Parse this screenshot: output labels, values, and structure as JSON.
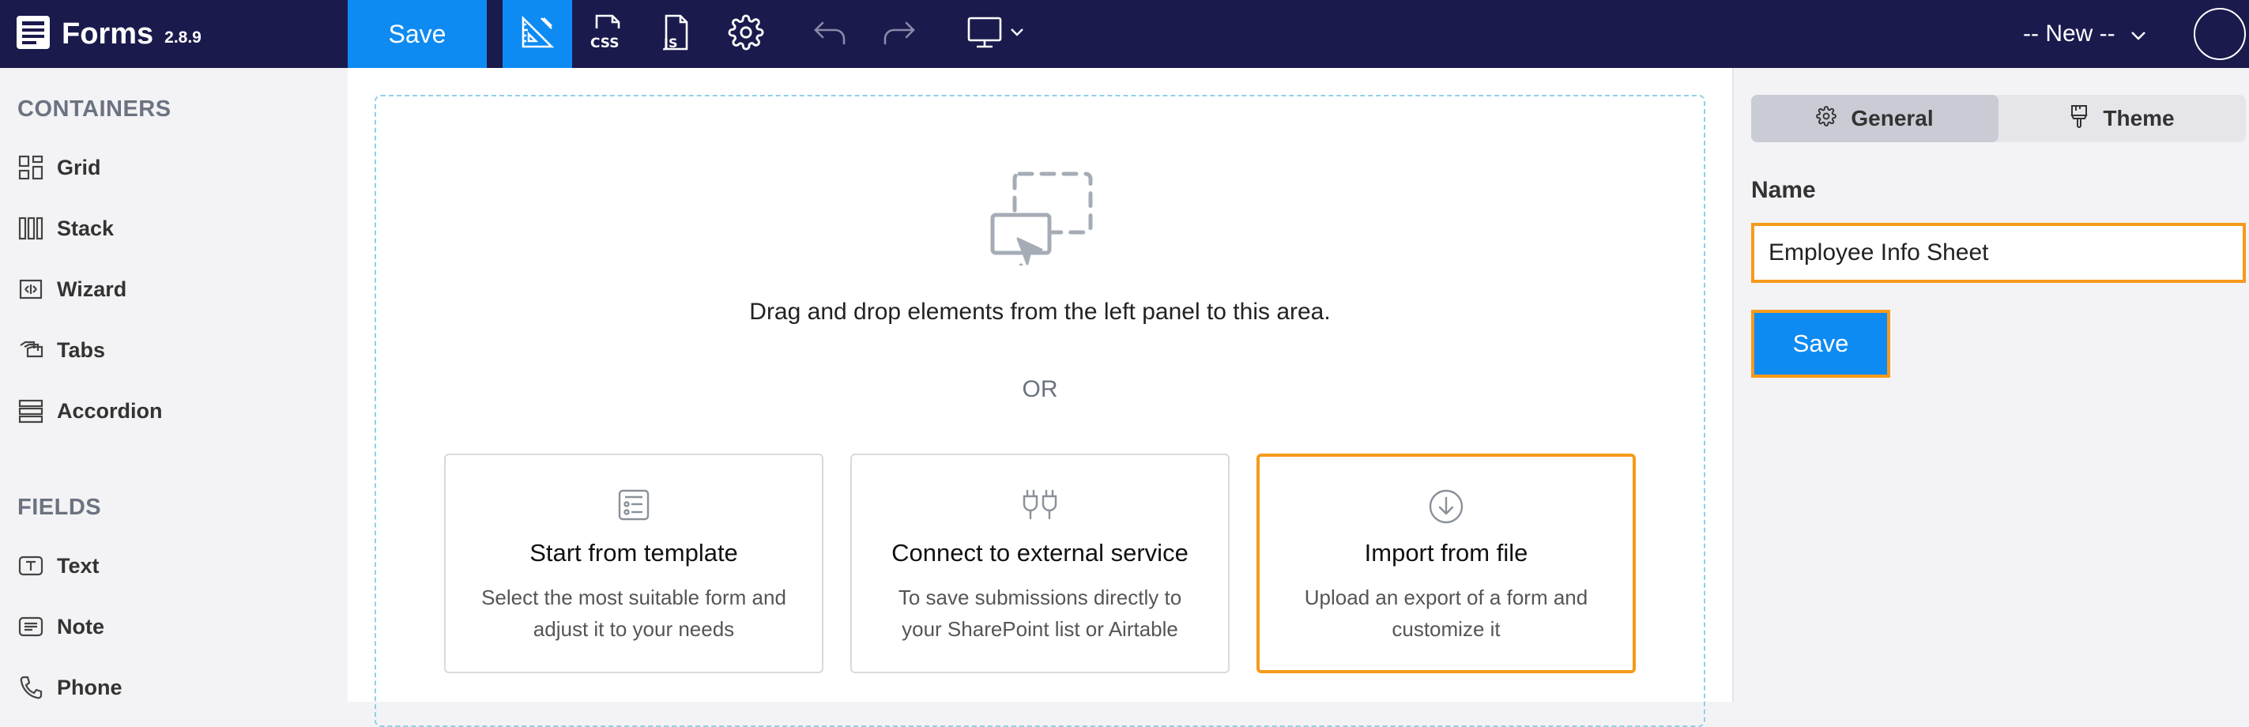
{
  "header": {
    "app_title": "Forms",
    "version": "2.8.9",
    "save_label": "Save",
    "new_select": "-- New --",
    "tools": [
      {
        "icon": "ruler-icon",
        "active": true
      },
      {
        "icon": "css-file-icon",
        "active": false
      },
      {
        "icon": "js-file-icon",
        "active": false
      },
      {
        "icon": "gear-icon",
        "active": false
      },
      {
        "icon": "undo-icon",
        "active": false
      },
      {
        "icon": "redo-icon",
        "active": false
      },
      {
        "icon": "monitor-icon",
        "active": false
      }
    ]
  },
  "left_panel": {
    "containers_title": "CONTAINERS",
    "containers": [
      {
        "label": "Grid",
        "icon": "grid-icon"
      },
      {
        "label": "Stack",
        "icon": "stack-icon"
      },
      {
        "label": "Wizard",
        "icon": "wizard-icon"
      },
      {
        "label": "Tabs",
        "icon": "tabs-icon"
      },
      {
        "label": "Accordion",
        "icon": "accordion-icon"
      }
    ],
    "fields_title": "FIELDS",
    "fields": [
      {
        "label": "Text",
        "icon": "text-field-icon"
      },
      {
        "label": "Note",
        "icon": "note-icon"
      },
      {
        "label": "Phone",
        "icon": "phone-icon"
      }
    ]
  },
  "canvas": {
    "drop_text": "Drag and drop elements from the left panel to this area.",
    "or_text": "OR",
    "cards": [
      {
        "title": "Start from template",
        "desc_line1": "Select the most suitable form and",
        "desc_line2": "adjust it to your needs",
        "icon": "template-icon",
        "selected": false
      },
      {
        "title": "Connect to external service",
        "desc_line1": "To save submissions directly to",
        "desc_line2": "your SharePoint list or Airtable",
        "icon": "plug-icon",
        "selected": false
      },
      {
        "title": "Import from file",
        "desc_line1": "Upload an export of a form and",
        "desc_line2": "customize it",
        "icon": "download-circle-icon",
        "selected": true
      }
    ]
  },
  "right_panel": {
    "tabs": [
      {
        "label": "General",
        "icon": "gear-icon",
        "active": true
      },
      {
        "label": "Theme",
        "icon": "brush-icon",
        "active": false
      }
    ],
    "name_label": "Name",
    "name_value": "Employee Info Sheet",
    "save_label": "Save"
  },
  "colors": {
    "topbar": "#1b1a4d",
    "accent": "#0d8bf2",
    "highlight": "#f59a1b",
    "dropzone_border": "#8fd0e6"
  }
}
